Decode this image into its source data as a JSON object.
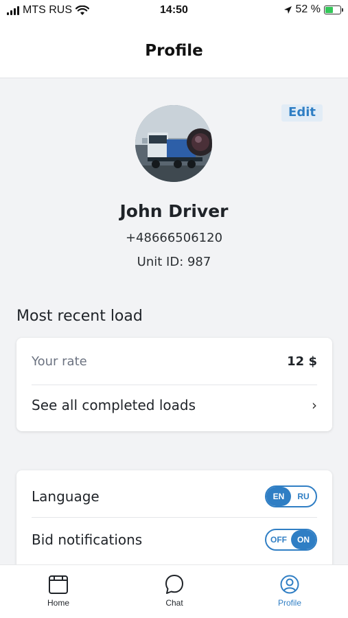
{
  "status_bar": {
    "carrier": "MTS RUS",
    "time": "14:50",
    "battery_percent": "52 %",
    "battery_level": 0.52
  },
  "header": {
    "title": "Profile"
  },
  "profile": {
    "edit_label": "Edit",
    "name": "John Driver",
    "phone": "+48666506120",
    "unit_id": "Unit ID: 987"
  },
  "recent_load": {
    "section_title": "Most recent load",
    "rate_label": "Your rate",
    "rate_value": "12 $",
    "see_all_label": "See all completed loads",
    "chevron": "›"
  },
  "settings": {
    "language_label": "Language",
    "language_options": [
      "EN",
      "RU"
    ],
    "language_selected": "EN",
    "bid_notifications_label": "Bid notifications",
    "bid_notifications_options": [
      "OFF",
      "ON"
    ],
    "bid_notifications_selected": "ON"
  },
  "tab_bar": {
    "tabs": [
      {
        "label": "Home",
        "icon": "home-icon"
      },
      {
        "label": "Chat",
        "icon": "chat-icon"
      },
      {
        "label": "Profile",
        "icon": "profile-icon"
      }
    ],
    "active": "Profile"
  },
  "colors": {
    "accent": "#2f7ec4",
    "background": "#f2f3f5",
    "card": "#ffffff",
    "edit_bg": "#e2ecf6"
  }
}
